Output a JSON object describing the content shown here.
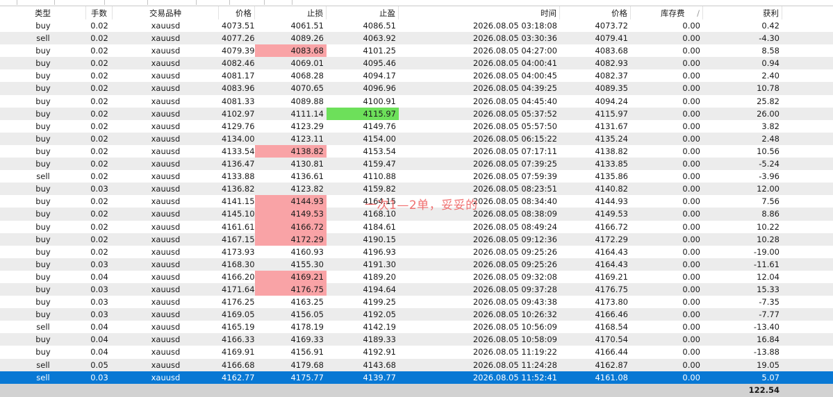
{
  "columns": {
    "type": "类型",
    "lots": "手数",
    "symbol": "交易品种",
    "open_price": "价格",
    "stop_loss": "止损",
    "take_profit": "止盈",
    "time": "时间",
    "close_price": "价格",
    "swap": "库存费",
    "profit": "获利"
  },
  "sort_indicator": "/",
  "rows": [
    {
      "type": "buy",
      "lots": "0.02",
      "symbol": "xauusd",
      "open": "4073.51",
      "sl": "4061.51",
      "tp": "4086.51",
      "time": "2026.08.05 03:18:08",
      "close": "4073.72",
      "swap": "0.00",
      "profit": "0.42",
      "sl_hl": "",
      "tp_hl": ""
    },
    {
      "type": "sell",
      "lots": "0.02",
      "symbol": "xauusd",
      "open": "4077.26",
      "sl": "4089.26",
      "tp": "4063.92",
      "time": "2026.08.05 03:30:36",
      "close": "4079.41",
      "swap": "0.00",
      "profit": "-4.30",
      "sl_hl": "",
      "tp_hl": ""
    },
    {
      "type": "buy",
      "lots": "0.02",
      "symbol": "xauusd",
      "open": "4079.39",
      "sl": "4083.68",
      "tp": "4101.25",
      "time": "2026.08.05 04:27:00",
      "close": "4083.68",
      "swap": "0.00",
      "profit": "8.58",
      "sl_hl": "red",
      "tp_hl": ""
    },
    {
      "type": "buy",
      "lots": "0.02",
      "symbol": "xauusd",
      "open": "4082.46",
      "sl": "4069.01",
      "tp": "4095.46",
      "time": "2026.08.05 04:00:41",
      "close": "4082.93",
      "swap": "0.00",
      "profit": "0.94",
      "sl_hl": "",
      "tp_hl": ""
    },
    {
      "type": "buy",
      "lots": "0.02",
      "symbol": "xauusd",
      "open": "4081.17",
      "sl": "4068.28",
      "tp": "4094.17",
      "time": "2026.08.05 04:00:45",
      "close": "4082.37",
      "swap": "0.00",
      "profit": "2.40",
      "sl_hl": "",
      "tp_hl": ""
    },
    {
      "type": "buy",
      "lots": "0.02",
      "symbol": "xauusd",
      "open": "4083.96",
      "sl": "4070.65",
      "tp": "4096.96",
      "time": "2026.08.05 04:39:25",
      "close": "4089.35",
      "swap": "0.00",
      "profit": "10.78",
      "sl_hl": "",
      "tp_hl": ""
    },
    {
      "type": "buy",
      "lots": "0.02",
      "symbol": "xauusd",
      "open": "4081.33",
      "sl": "4089.88",
      "tp": "4100.91",
      "time": "2026.08.05 04:45:40",
      "close": "4094.24",
      "swap": "0.00",
      "profit": "25.82",
      "sl_hl": "",
      "tp_hl": ""
    },
    {
      "type": "buy",
      "lots": "0.02",
      "symbol": "xauusd",
      "open": "4102.97",
      "sl": "4111.14",
      "tp": "4115.97",
      "time": "2026.08.05 05:37:52",
      "close": "4115.97",
      "swap": "0.00",
      "profit": "26.00",
      "sl_hl": "",
      "tp_hl": "green"
    },
    {
      "type": "buy",
      "lots": "0.02",
      "symbol": "xauusd",
      "open": "4129.76",
      "sl": "4123.29",
      "tp": "4149.76",
      "time": "2026.08.05 05:57:50",
      "close": "4131.67",
      "swap": "0.00",
      "profit": "3.82",
      "sl_hl": "",
      "tp_hl": ""
    },
    {
      "type": "buy",
      "lots": "0.02",
      "symbol": "xauusd",
      "open": "4134.00",
      "sl": "4123.11",
      "tp": "4154.00",
      "time": "2026.08.05 06:15:22",
      "close": "4135.24",
      "swap": "0.00",
      "profit": "2.48",
      "sl_hl": "",
      "tp_hl": ""
    },
    {
      "type": "buy",
      "lots": "0.02",
      "symbol": "xauusd",
      "open": "4133.54",
      "sl": "4138.82",
      "tp": "4153.54",
      "time": "2026.08.05 07:17:11",
      "close": "4138.82",
      "swap": "0.00",
      "profit": "10.56",
      "sl_hl": "red",
      "tp_hl": ""
    },
    {
      "type": "buy",
      "lots": "0.02",
      "symbol": "xauusd",
      "open": "4136.47",
      "sl": "4130.81",
      "tp": "4159.47",
      "time": "2026.08.05 07:39:25",
      "close": "4133.85",
      "swap": "0.00",
      "profit": "-5.24",
      "sl_hl": "",
      "tp_hl": ""
    },
    {
      "type": "sell",
      "lots": "0.02",
      "symbol": "xauusd",
      "open": "4133.88",
      "sl": "4136.61",
      "tp": "4110.88",
      "time": "2026.08.05 07:59:39",
      "close": "4135.86",
      "swap": "0.00",
      "profit": "-3.96",
      "sl_hl": "",
      "tp_hl": ""
    },
    {
      "type": "buy",
      "lots": "0.03",
      "symbol": "xauusd",
      "open": "4136.82",
      "sl": "4123.82",
      "tp": "4159.82",
      "time": "2026.08.05 08:23:51",
      "close": "4140.82",
      "swap": "0.00",
      "profit": "12.00",
      "sl_hl": "",
      "tp_hl": ""
    },
    {
      "type": "buy",
      "lots": "0.02",
      "symbol": "xauusd",
      "open": "4141.15",
      "sl": "4144.93",
      "tp": "4164.15",
      "time": "2026.08.05 08:34:40",
      "close": "4144.93",
      "swap": "0.00",
      "profit": "7.56",
      "sl_hl": "red",
      "tp_hl": ""
    },
    {
      "type": "buy",
      "lots": "0.02",
      "symbol": "xauusd",
      "open": "4145.10",
      "sl": "4149.53",
      "tp": "4168.10",
      "time": "2026.08.05 08:38:09",
      "close": "4149.53",
      "swap": "0.00",
      "profit": "8.86",
      "sl_hl": "red",
      "tp_hl": ""
    },
    {
      "type": "buy",
      "lots": "0.02",
      "symbol": "xauusd",
      "open": "4161.61",
      "sl": "4166.72",
      "tp": "4184.61",
      "time": "2026.08.05 08:49:24",
      "close": "4166.72",
      "swap": "0.00",
      "profit": "10.22",
      "sl_hl": "red",
      "tp_hl": ""
    },
    {
      "type": "buy",
      "lots": "0.02",
      "symbol": "xauusd",
      "open": "4167.15",
      "sl": "4172.29",
      "tp": "4190.15",
      "time": "2026.08.05 09:12:36",
      "close": "4172.29",
      "swap": "0.00",
      "profit": "10.28",
      "sl_hl": "red",
      "tp_hl": ""
    },
    {
      "type": "buy",
      "lots": "0.02",
      "symbol": "xauusd",
      "open": "4173.93",
      "sl": "4160.93",
      "tp": "4196.93",
      "time": "2026.08.05 09:25:26",
      "close": "4164.43",
      "swap": "0.00",
      "profit": "-19.00",
      "sl_hl": "",
      "tp_hl": ""
    },
    {
      "type": "buy",
      "lots": "0.03",
      "symbol": "xauusd",
      "open": "4168.30",
      "sl": "4155.30",
      "tp": "4191.30",
      "time": "2026.08.05 09:25:26",
      "close": "4164.43",
      "swap": "0.00",
      "profit": "-11.61",
      "sl_hl": "",
      "tp_hl": ""
    },
    {
      "type": "buy",
      "lots": "0.04",
      "symbol": "xauusd",
      "open": "4166.20",
      "sl": "4169.21",
      "tp": "4189.20",
      "time": "2026.08.05 09:32:08",
      "close": "4169.21",
      "swap": "0.00",
      "profit": "12.04",
      "sl_hl": "red",
      "tp_hl": ""
    },
    {
      "type": "buy",
      "lots": "0.03",
      "symbol": "xauusd",
      "open": "4171.64",
      "sl": "4176.75",
      "tp": "4194.64",
      "time": "2026.08.05 09:37:28",
      "close": "4176.75",
      "swap": "0.00",
      "profit": "15.33",
      "sl_hl": "red",
      "tp_hl": ""
    },
    {
      "type": "buy",
      "lots": "0.03",
      "symbol": "xauusd",
      "open": "4176.25",
      "sl": "4163.25",
      "tp": "4199.25",
      "time": "2026.08.05 09:43:38",
      "close": "4173.80",
      "swap": "0.00",
      "profit": "-7.35",
      "sl_hl": "",
      "tp_hl": ""
    },
    {
      "type": "buy",
      "lots": "0.03",
      "symbol": "xauusd",
      "open": "4169.05",
      "sl": "4156.05",
      "tp": "4192.05",
      "time": "2026.08.05 10:26:32",
      "close": "4166.46",
      "swap": "0.00",
      "profit": "-7.77",
      "sl_hl": "",
      "tp_hl": ""
    },
    {
      "type": "sell",
      "lots": "0.04",
      "symbol": "xauusd",
      "open": "4165.19",
      "sl": "4178.19",
      "tp": "4142.19",
      "time": "2026.08.05 10:56:09",
      "close": "4168.54",
      "swap": "0.00",
      "profit": "-13.40",
      "sl_hl": "",
      "tp_hl": ""
    },
    {
      "type": "buy",
      "lots": "0.04",
      "symbol": "xauusd",
      "open": "4166.33",
      "sl": "4169.33",
      "tp": "4189.33",
      "time": "2026.08.05 10:58:09",
      "close": "4170.54",
      "swap": "0.00",
      "profit": "16.84",
      "sl_hl": "",
      "tp_hl": ""
    },
    {
      "type": "buy",
      "lots": "0.04",
      "symbol": "xauusd",
      "open": "4169.91",
      "sl": "4156.91",
      "tp": "4192.91",
      "time": "2026.08.05 11:19:22",
      "close": "4166.44",
      "swap": "0.00",
      "profit": "-13.88",
      "sl_hl": "",
      "tp_hl": ""
    },
    {
      "type": "sell",
      "lots": "0.05",
      "symbol": "xauusd",
      "open": "4166.68",
      "sl": "4179.68",
      "tp": "4143.68",
      "time": "2026.08.05 11:24:28",
      "close": "4162.87",
      "swap": "0.00",
      "profit": "19.05",
      "sl_hl": "",
      "tp_hl": ""
    },
    {
      "type": "sell",
      "lots": "0.03",
      "symbol": "xauusd",
      "open": "4162.77",
      "sl": "4175.77",
      "tp": "4139.77",
      "time": "2026.08.05 11:52:41",
      "close": "4161.08",
      "swap": "0.00",
      "profit": "5.07",
      "sl_hl": "",
      "tp_hl": "",
      "selected": true
    }
  ],
  "total_profit": "122.54",
  "annotation": "一次1—2单，妥妥的",
  "colors": {
    "stop_hit_red": "#f9a3a6",
    "take_profit_green": "#6de05a",
    "selected_blue": "#0878d4",
    "annotation_red": "#f07070"
  }
}
